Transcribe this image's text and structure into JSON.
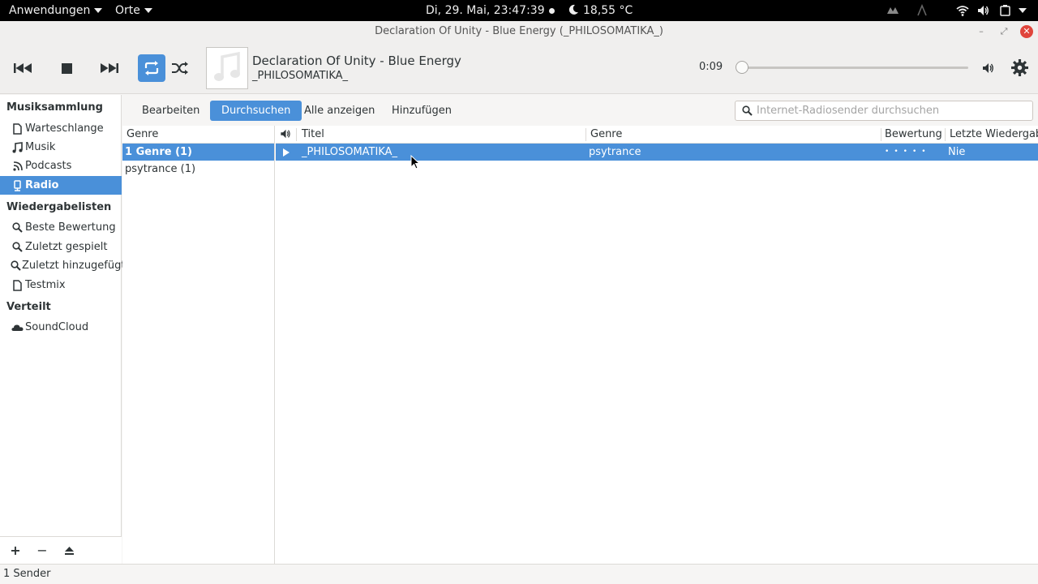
{
  "topbar": {
    "apps_label": "Anwendungen",
    "places_label": "Orte",
    "datetime": "Di, 29. Mai, 23:47:39",
    "weather": "18,55 °C"
  },
  "window": {
    "title": "Declaration Of Unity - Blue Energy (_PHILOSOMATIKA_)"
  },
  "player": {
    "title": "Declaration Of Unity - Blue Energy",
    "artist": "_PHILOSOMATIKA_",
    "elapsed": "0:09",
    "progress": 0.0
  },
  "sidebar": {
    "sections": [
      {
        "header": "Musiksammlung"
      },
      {
        "header": "Wiedergabelisten"
      },
      {
        "header": "Verteilt"
      }
    ],
    "library": [
      {
        "label": "Warteschlange",
        "icon": "document-icon"
      },
      {
        "label": "Musik",
        "icon": "music-note-icon"
      },
      {
        "label": "Podcasts",
        "icon": "rss-icon"
      },
      {
        "label": "Radio",
        "icon": "radio-icon"
      }
    ],
    "playlists": [
      {
        "label": "Beste Bewertung",
        "icon": "search-icon"
      },
      {
        "label": "Zuletzt gespielt",
        "icon": "search-icon"
      },
      {
        "label": "Zuletzt hinzugefügt",
        "icon": "search-icon"
      },
      {
        "label": "Testmix",
        "icon": "document-icon"
      }
    ],
    "shared": [
      {
        "label": "SoundCloud",
        "icon": "cloud-icon"
      }
    ],
    "bottom": {
      "add": "+",
      "remove": "−"
    }
  },
  "subbar": {
    "buttons": [
      "Bearbeiten",
      "Durchsuchen",
      "Alle anzeigen",
      "Hinzufügen"
    ],
    "active": "Durchsuchen",
    "search_placeholder": "Internet-Radiosender durchsuchen"
  },
  "genre_pane": {
    "header": "Genre",
    "rows": [
      "1 Genre (1)",
      "psytrance (1)"
    ]
  },
  "tracks": {
    "headers": {
      "title": "Titel",
      "genre": "Genre",
      "rating": "Bewertung",
      "last_played": "Letzte Wiedergabe"
    },
    "rows": [
      {
        "title": "_PHILOSOMATIKA_",
        "genre": "psytrance",
        "rating": 0,
        "last_played": "Nie"
      }
    ]
  },
  "status": "1 Sender",
  "colors": {
    "accent": "#4a90d9",
    "close": "#e0453c"
  }
}
